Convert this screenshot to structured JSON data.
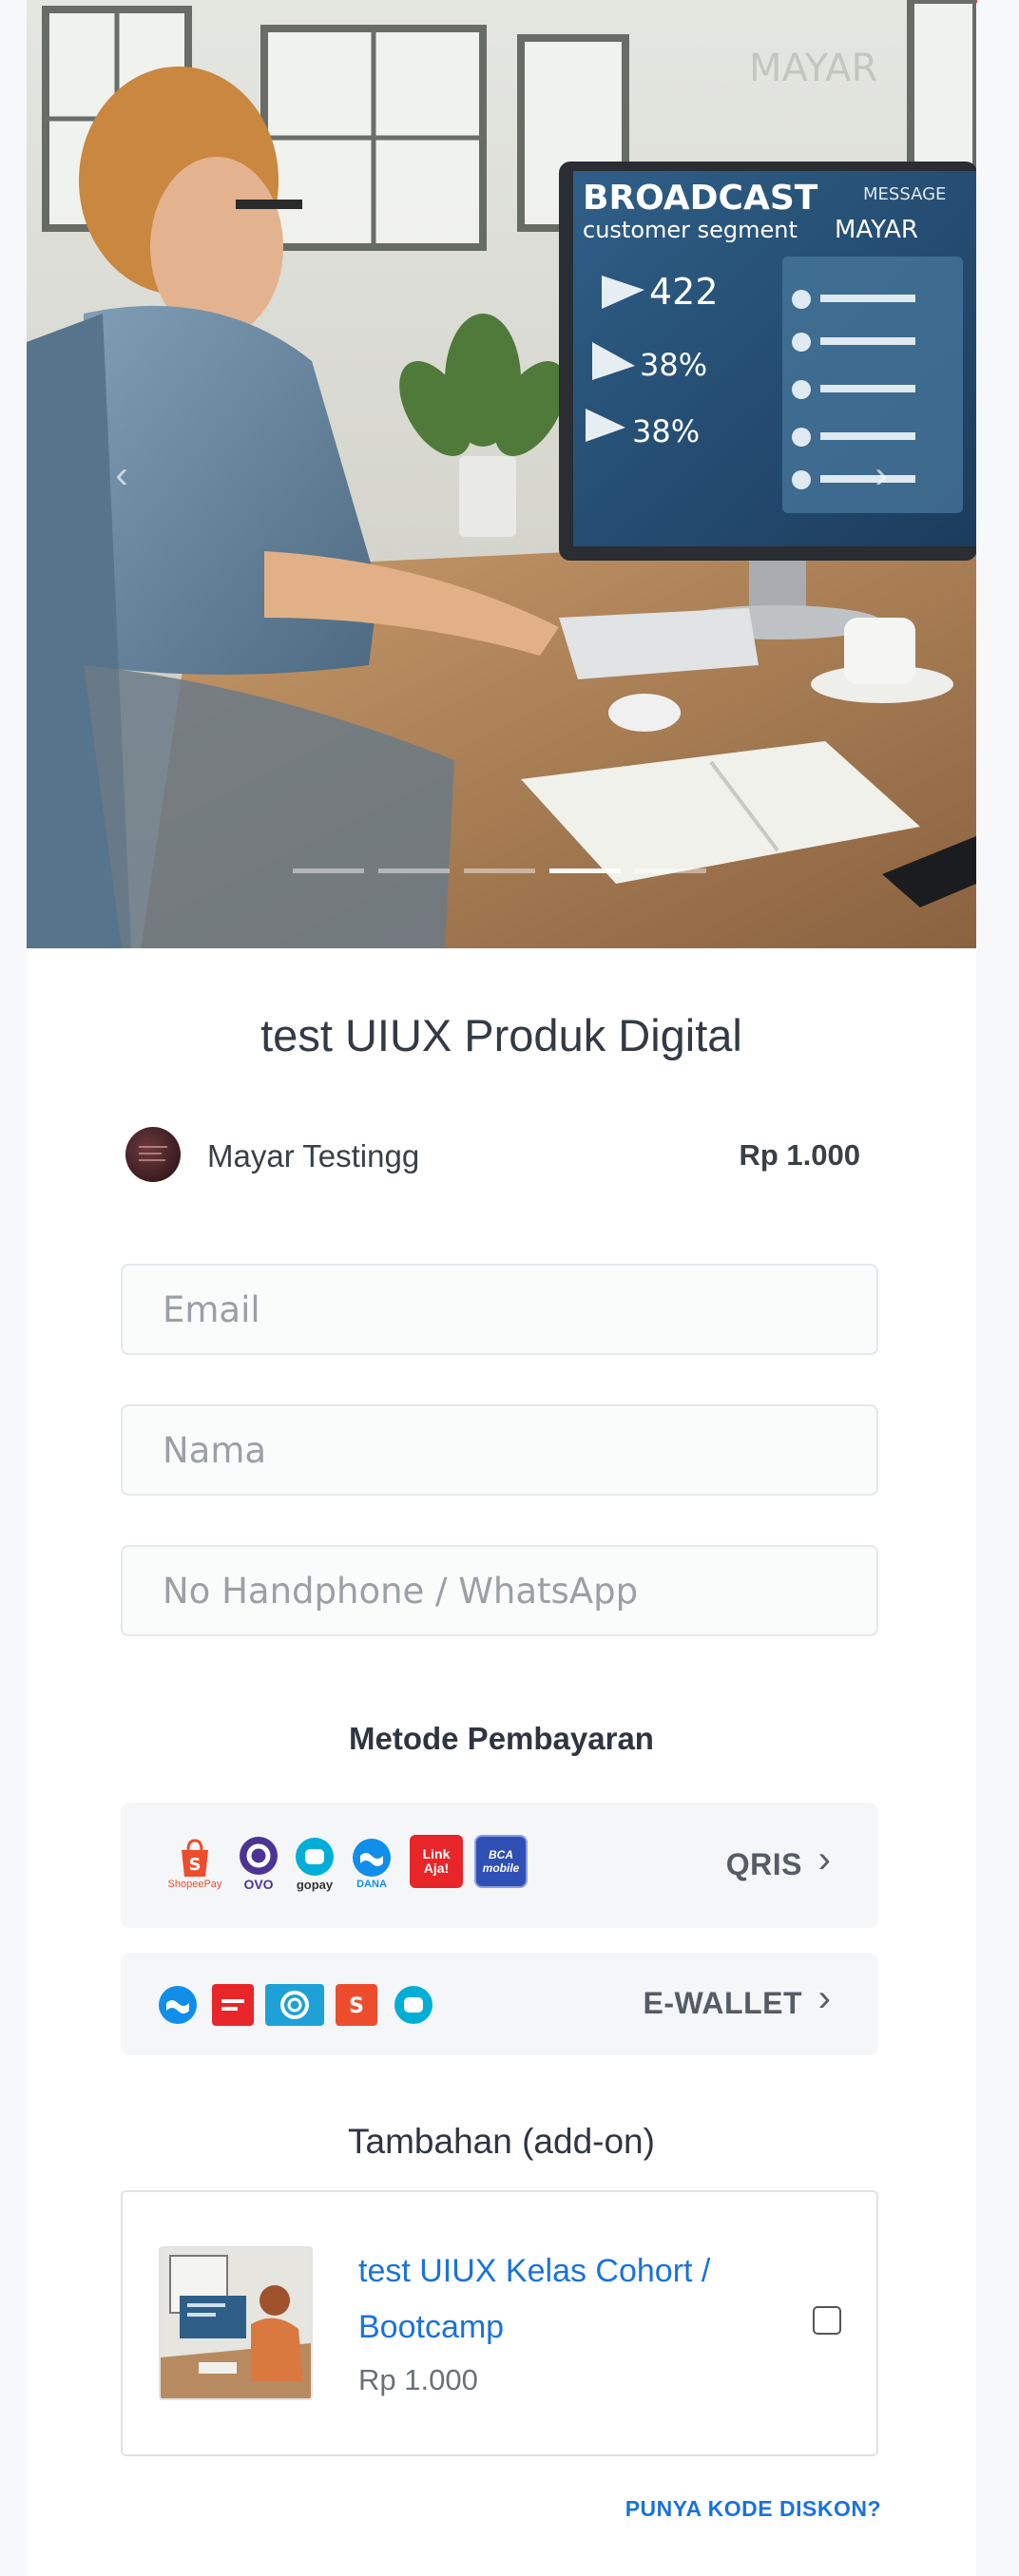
{
  "colors": {
    "accent": "#1a73d9",
    "page_bg": "#f7f8fa",
    "top_accent": "#e53935"
  },
  "hero": {
    "screen_heading_1": "BROADCAST",
    "screen_heading_2": "customer segment",
    "screen_side_title": "MESSAGE",
    "screen_brand": "MAYAR",
    "screen_stats": [
      "422",
      "38%",
      "38%"
    ],
    "wall_brand": "MAYAR",
    "prev_icon": "chevron-left-icon",
    "next_icon": "chevron-right-icon",
    "slide_count": 5,
    "active_slide": 4
  },
  "product": {
    "title": "test UIUX Produk Digital",
    "seller": "Mayar Testingg",
    "price": "Rp 1.000"
  },
  "form": {
    "email_placeholder": "Email",
    "name_placeholder": "Nama",
    "phone_placeholder": "No Handphone / WhatsApp"
  },
  "payment": {
    "title": "Metode Pembayaran",
    "qris": {
      "label": "QRIS",
      "logos": [
        {
          "icon": "shopeepay-icon",
          "caption": "ShopeePay"
        },
        {
          "icon": "ovo-icon",
          "caption": "OVO"
        },
        {
          "icon": "gopay-icon",
          "caption": "gopay"
        },
        {
          "icon": "dana-icon",
          "caption": "DANA"
        },
        {
          "icon": "linkaja-icon",
          "caption": "Link Aja!"
        },
        {
          "icon": "bca-mobile-icon",
          "caption": "BCA mobile"
        }
      ]
    },
    "ewallet": {
      "label": "E-WALLET",
      "logos": [
        "dana-icon",
        "linkaja-icon",
        "ovo-icon",
        "shopeepay-icon",
        "gopay-icon"
      ]
    }
  },
  "addon": {
    "title": "Tambahan (add-on)",
    "name": "test UIUX Kelas Cohort / Bootcamp",
    "price": "Rp 1.000",
    "checked": false
  },
  "discount_link": "PUNYA KODE DISKON?"
}
